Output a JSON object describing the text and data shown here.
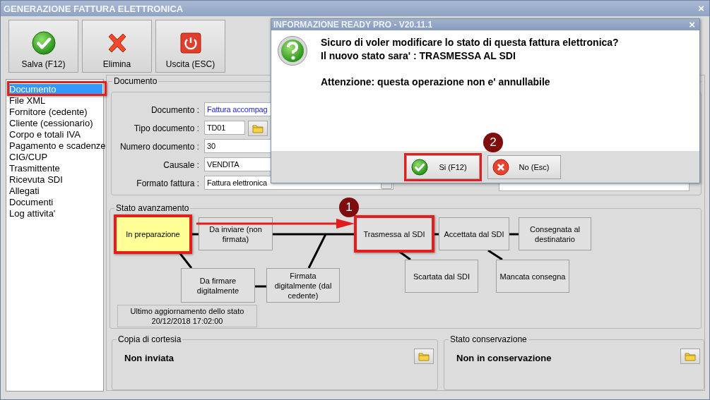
{
  "window": {
    "title": "GENERAZIONE FATTURA ELETTRONICA",
    "close": "×"
  },
  "toolbar": [
    {
      "label": "Salva (F12)",
      "kind": "save"
    },
    {
      "label": "Elimina",
      "kind": "delete"
    },
    {
      "label": "Uscita (ESC)",
      "kind": "exit"
    }
  ],
  "sidebar": {
    "items": [
      {
        "label": "Documento",
        "selected": true,
        "highlighted": true
      },
      {
        "label": "File XML",
        "selected": false,
        "highlighted": false
      },
      {
        "label": "Fornitore (cedente)",
        "selected": false,
        "highlighted": false
      },
      {
        "label": "Cliente (cessionario)",
        "selected": false,
        "highlighted": false
      },
      {
        "label": "Corpo e totali IVA",
        "selected": false,
        "highlighted": false
      },
      {
        "label": "Pagamento e scadenze",
        "selected": false,
        "highlighted": false
      },
      {
        "label": "CIG/CUP",
        "selected": false,
        "highlighted": false
      },
      {
        "label": "Trasmittente",
        "selected": false,
        "highlighted": false
      },
      {
        "label": "Ricevuta SDI",
        "selected": false,
        "highlighted": false
      },
      {
        "label": "Allegati",
        "selected": false,
        "highlighted": false
      },
      {
        "label": "Documenti",
        "selected": false,
        "highlighted": false
      },
      {
        "label": "Log attivita'",
        "selected": false,
        "highlighted": false
      }
    ]
  },
  "documento": {
    "title": "Documento",
    "fields": [
      {
        "label": "Documento :",
        "value": "Fattura accompag",
        "kind": "link"
      },
      {
        "label": "Tipo documento :",
        "value": "TD01",
        "kind": "lookup"
      },
      {
        "label": "Numero documento :",
        "value": "30",
        "kind": "text"
      },
      {
        "label": "Causale :",
        "value": "VENDITA",
        "kind": "text"
      },
      {
        "label": "Formato fattura :",
        "value": "Fattura elettronica",
        "kind": "combo"
      }
    ]
  },
  "stato_avanzamento": {
    "title": "Stato avanzamento",
    "nodes": [
      {
        "label": "In preparazione",
        "current": true,
        "highlighted": true
      },
      {
        "label": "Da inviare (non firmata)",
        "current": false,
        "highlighted": false
      },
      {
        "label": "Trasmessa al SDI",
        "current": false,
        "highlighted": true
      },
      {
        "label": "Accettata dal SDI",
        "current": false,
        "highlighted": false
      },
      {
        "label": "Consegnata al destinatario",
        "current": false,
        "highlighted": false
      },
      {
        "label": "Da firmare digitalmente",
        "current": false,
        "highlighted": false
      },
      {
        "label": "Firmata digitalmente (dal cedente)",
        "current": false,
        "highlighted": false
      },
      {
        "label": "Scartata dal SDI",
        "current": false,
        "highlighted": false
      },
      {
        "label": "Mancata consegna",
        "current": false,
        "highlighted": false
      }
    ],
    "badge": "1",
    "last_update": {
      "label": "Ultimo aggiornamento dello stato",
      "value": "20/12/2018 17:02:00"
    }
  },
  "copia_di_cortesia": {
    "title": "Copia di cortesia",
    "value": "Non inviata"
  },
  "stato_conservazione": {
    "title": "Stato conservazione",
    "value": "Non in conservazione"
  },
  "dialog": {
    "title": "INFORMAZIONE READY PRO - V20.11.1",
    "close": "×",
    "lines": [
      "Sicuro di voler modificare lo stato di questa fattura elettronica?",
      "Il nuovo stato sara' : TRASMESSA AL SDI",
      "Attenzione: questa operazione non e' annullabile"
    ],
    "badge": "2",
    "buttons": [
      {
        "label": "Si (F12)",
        "kind": "yes",
        "highlighted": true
      },
      {
        "label": "No (Esc)",
        "kind": "no",
        "highlighted": false
      }
    ]
  }
}
